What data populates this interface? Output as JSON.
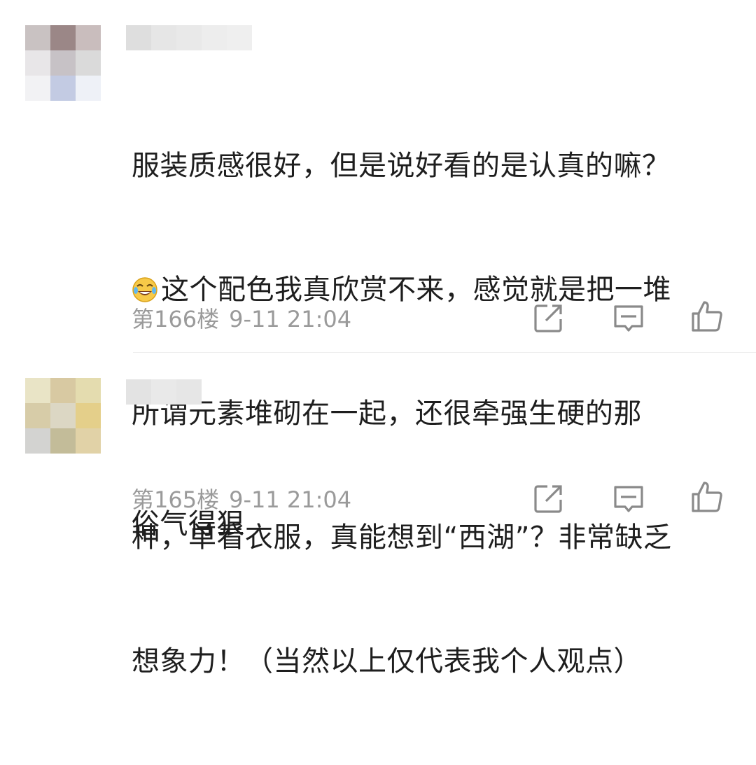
{
  "comments": [
    {
      "floor": "第166楼",
      "time": "9-11 21:04",
      "text_line1": "服装质感很好，但是说好看的是认真的嘛？",
      "text_line2": "这个配色我真欣赏不来，感觉就是把一堆",
      "text_line3": "所谓元素堆砌在一起，还很牵强生硬的那",
      "text_line4": "种，单看衣服，真能想到“西湖”？非常缺乏",
      "text_line5": "想象力！（当然以上仅代表我个人观点）",
      "emoji": "laugh-cry-emoji",
      "avatar_colors": [
        "#c9c2c2",
        "#9b8787",
        "#c9bdbd",
        "#e8e6e8",
        "#c7c2c6",
        "#dadada",
        "#f2f2f4",
        "#c3cbe3",
        "#eef1f7"
      ],
      "username_colors": [
        "#dedede",
        "#e6e6e6",
        "#e9e9e9",
        "#ededed",
        "#efefef"
      ]
    },
    {
      "floor": "第165楼",
      "time": "9-11 21:04",
      "text_line1": "俗气得狠",
      "avatar_colors": [
        "#e9e4c6",
        "#d8c9a2",
        "#e4dcaf",
        "#d7cca8",
        "#dcd7c4",
        "#e4cf8a",
        "#d3d3d1",
        "#c3bc99",
        "#e1d2a7"
      ],
      "username_colors": [
        "#e3e3e3",
        "#e9e9e9",
        "#e6e6e6"
      ]
    }
  ],
  "icons": {
    "share": "share-icon",
    "comment": "comment-icon",
    "like": "thumbs-up-icon"
  },
  "colors": {
    "text": "#1e1e1e",
    "meta": "#9a9a9a",
    "icon": "#8a8a8a",
    "divider": "#ececec"
  }
}
